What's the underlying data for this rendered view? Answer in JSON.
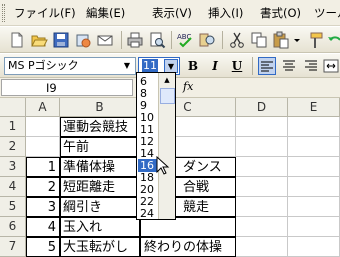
{
  "menubar": {
    "items": [
      {
        "label": "ファイル(F)"
      },
      {
        "label": "編集(E)"
      },
      {
        "label": "表示(V)"
      },
      {
        "label": "挿入(I)"
      },
      {
        "label": "書式(O)"
      },
      {
        "label": "ツール"
      }
    ]
  },
  "format_toolbar": {
    "font_name": "MS Pゴシック",
    "font_size": "11",
    "bold_label": "B",
    "italic_label": "I",
    "underline_label": "U"
  },
  "formula_bar": {
    "name_box": "I9",
    "fx_label": "fx"
  },
  "columns": [
    "A",
    "B",
    "C",
    "D",
    "E"
  ],
  "rows": [
    {
      "num": "1",
      "a": "",
      "b": "運動会競技",
      "c": ""
    },
    {
      "num": "2",
      "a": "",
      "b": "午前",
      "c": ""
    },
    {
      "num": "3",
      "a": "1",
      "b": "準備体操",
      "c": "ダンス"
    },
    {
      "num": "4",
      "a": "2",
      "b": "短距離走",
      "c": "合戦"
    },
    {
      "num": "5",
      "a": "3",
      "b": "綱引き",
      "c": "競走"
    },
    {
      "num": "6",
      "a": "4",
      "b": "玉入れ",
      "c": ""
    },
    {
      "num": "7",
      "a": "5",
      "b": "大玉転がし",
      "c": "終わりの体操"
    }
  ],
  "font_size_dropdown": {
    "options": [
      "6",
      "8",
      "9",
      "10",
      "11",
      "12",
      "14",
      "16",
      "18",
      "20",
      "22",
      "24"
    ],
    "selected": "16"
  },
  "colors": {
    "selection": "#316ac5",
    "toolbar_bg": "#e6e2d2",
    "header_bg": "#f0efe7"
  }
}
